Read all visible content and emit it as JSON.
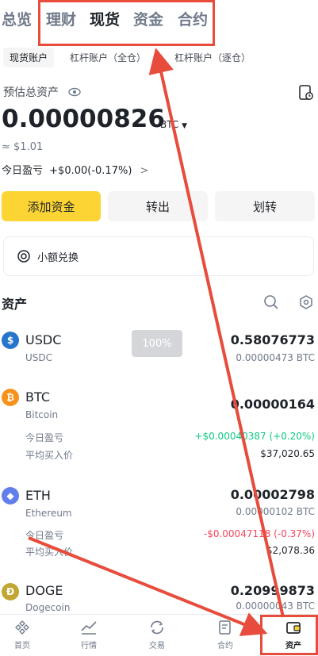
{
  "top_tabs": [
    "总览",
    "理财",
    "现货",
    "资金",
    "合约"
  ],
  "sub_tabs": [
    "现货账户",
    "杠杆账户（全仓）",
    "杠杆账户（逐仓）"
  ],
  "balance": {
    "label": "预估总资产",
    "value": "0.00000826",
    "unit": "BTC",
    "approx": "≈ $1.01",
    "pnl_label": "今日盈亏",
    "pnl_value": "+$0.00(-0.17%)",
    "pnl_chevron": ">"
  },
  "actions": {
    "deposit": "添加资金",
    "transfer_out": "转出",
    "transfer": "划转"
  },
  "small_exchange": "小额兑换",
  "assets_title": "资产",
  "assets": [
    {
      "symbol": "USDC",
      "name": "USDC",
      "amount": "0.58076773",
      "btc": "0.00000473 BTC",
      "badge": "100%",
      "icon_color": "#2775ca",
      "icon": "$"
    },
    {
      "symbol": "BTC",
      "name": "Bitcoin",
      "amount": "0.00000164",
      "btc": "",
      "icon_color": "#f7931a",
      "icon": "₿",
      "pnl_label": "今日盈亏",
      "pnl": "+$0.00040387 (+0.20%)",
      "avg_label": "平均买入价",
      "avg": "$37,020.65"
    },
    {
      "symbol": "ETH",
      "name": "Ethereum",
      "amount": "0.00002798",
      "btc": "0.00000102 BTC",
      "icon_color": "#627eea",
      "icon": "◆",
      "pnl_label": "今日盈亏",
      "pnl": "-$0.00047118 (-0.37%)",
      "avg_label": "平均买入价",
      "avg": "$2,078.36"
    },
    {
      "symbol": "DOGE",
      "name": "Dogecoin",
      "amount": "0.20999873",
      "btc": "0.00000043 BTC",
      "icon_color": "#c2a633",
      "icon": "Ð"
    }
  ],
  "nav": [
    "首页",
    "行情",
    "交易",
    "合约",
    "资产"
  ],
  "colors": {
    "accent": "#fcd535",
    "positive": "#0ecb81",
    "negative": "#f6465d",
    "annotation": "#e74c3c"
  }
}
